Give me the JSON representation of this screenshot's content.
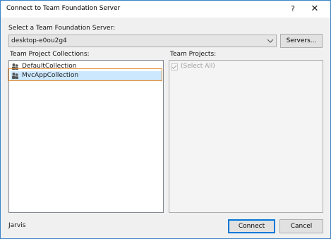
{
  "window": {
    "title": "Connect to Team Foundation Server",
    "help": "?",
    "close": "✕"
  },
  "server": {
    "label": "Select a Team Foundation Server:",
    "value": "desktop-e0ou2g4",
    "servers_button": "Servers..."
  },
  "collections": {
    "label": "Team Project Collections:",
    "items": [
      {
        "label": "DefaultCollection",
        "selected": false
      },
      {
        "label": "MvcAppCollection",
        "selected": true
      }
    ]
  },
  "projects": {
    "label": "Team Projects:",
    "select_all": "(Select All)",
    "select_all_checked": true
  },
  "footer": {
    "user": "Jarvis",
    "connect_button": "Connect",
    "cancel_button": "Cancel"
  }
}
